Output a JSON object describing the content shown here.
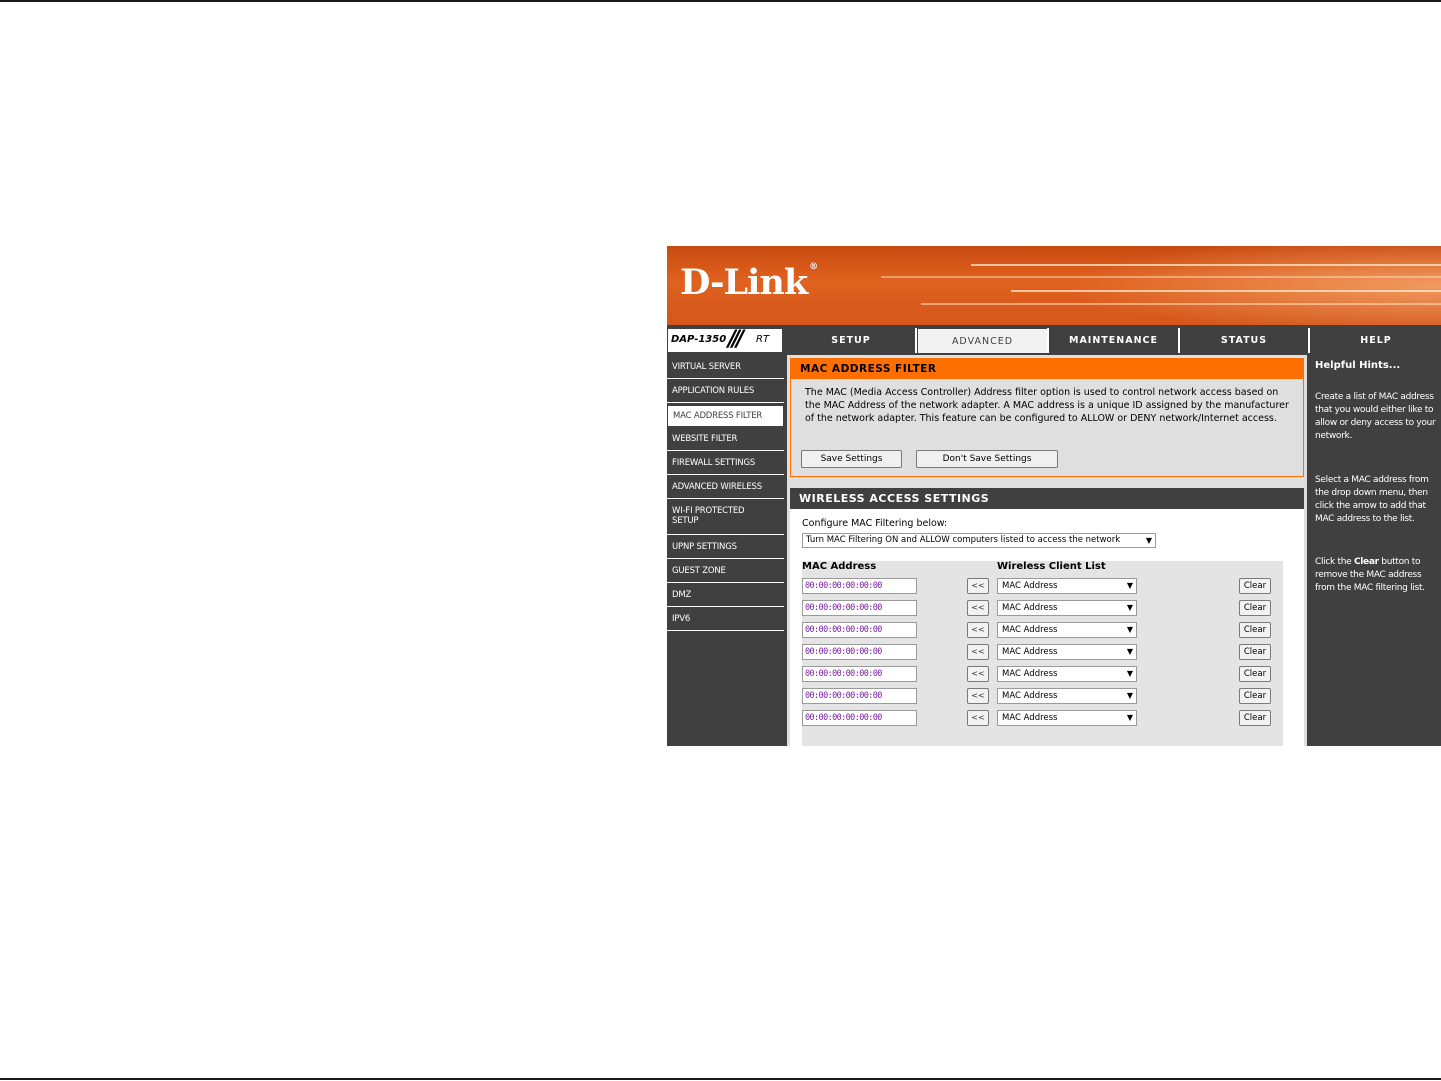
{
  "brand": {
    "logo": "D-Link",
    "trademark": "®",
    "model": "DAP-1350",
    "model_suffix": "RT",
    "slashes": "///"
  },
  "tabs": [
    {
      "label": "SETUP",
      "active": false
    },
    {
      "label": "ADVANCED",
      "active": true
    },
    {
      "label": "MAINTENANCE",
      "active": false
    },
    {
      "label": "STATUS",
      "active": false
    },
    {
      "label": "HELP",
      "active": false
    }
  ],
  "sidebar": [
    {
      "label": "VIRTUAL SERVER"
    },
    {
      "label": "APPLICATION RULES"
    },
    {
      "label": "MAC ADDRESS FILTER",
      "active": true
    },
    {
      "label": "WEBSITE FILTER"
    },
    {
      "label": "FIREWALL SETTINGS"
    },
    {
      "label": "ADVANCED WIRELESS"
    },
    {
      "label": "WI-FI PROTECTED SETUP"
    },
    {
      "label": "UPNP SETTINGS"
    },
    {
      "label": "GUEST ZONE"
    },
    {
      "label": "DMZ"
    },
    {
      "label": "IPV6"
    }
  ],
  "mac_filter": {
    "title": "MAC ADDRESS FILTER",
    "description": "The MAC (Media Access Controller) Address filter option is used to control network access based on the MAC Address of the network adapter. A MAC address is a unique ID assigned by the manufacturer of the network adapter. This feature can be configured to ALLOW or DENY network/Internet access.",
    "save_label": "Save Settings",
    "dont_save_label": "Don't Save Settings"
  },
  "wireless_access": {
    "title": "WIRELESS ACCESS SETTINGS",
    "configure_label": "Configure MAC Filtering below:",
    "filter_mode": "Turn MAC Filtering ON and ALLOW computers listed to access the network",
    "col_mac": "MAC Address",
    "col_client": "Wireless Client List",
    "arrow_label": "<<",
    "clear_label": "Clear",
    "rows": [
      {
        "mac": "00:00:00:00:00:00",
        "client": "MAC Address"
      },
      {
        "mac": "00:00:00:00:00:00",
        "client": "MAC Address"
      },
      {
        "mac": "00:00:00:00:00:00",
        "client": "MAC Address"
      },
      {
        "mac": "00:00:00:00:00:00",
        "client": "MAC Address"
      },
      {
        "mac": "00:00:00:00:00:00",
        "client": "MAC Address"
      },
      {
        "mac": "00:00:00:00:00:00",
        "client": "MAC Address"
      },
      {
        "mac": "00:00:00:00:00:00",
        "client": "MAC Address"
      }
    ]
  },
  "help": {
    "title": "Helpful Hints...",
    "hint1": "Create a list of MAC address that you would either like to allow or deny access to your network.",
    "hint2": "Select a MAC address from the drop down menu, then click the arrow to add that MAC address to the list.",
    "hint3_pre": "Click the ",
    "hint3_bold": "Clear",
    "hint3_post": " button to remove the MAC address from the MAC filtering list."
  },
  "colors": {
    "accent_orange": "#ff6f00",
    "nav_gray": "#404040",
    "banner_orange": "#d4561a",
    "mac_text": "#7a1fa0"
  }
}
